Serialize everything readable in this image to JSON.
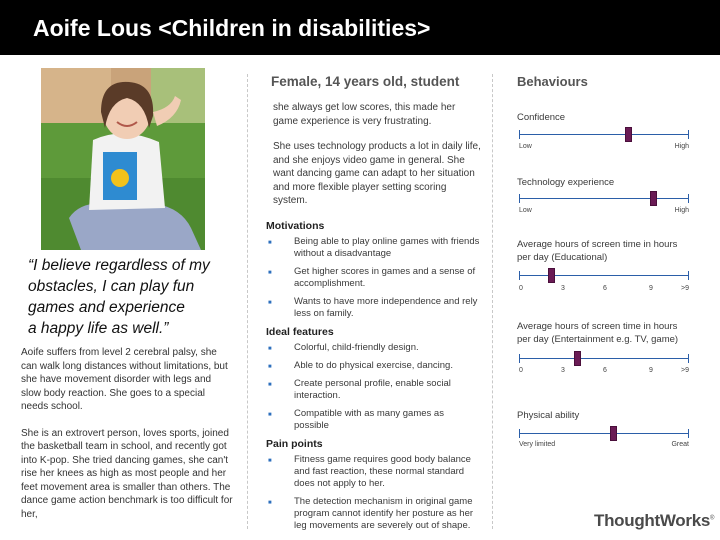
{
  "title": "Aoife Lous <Children in disabilities>",
  "quote": {
    "lines": [
      "“I believe regardless of my",
      "obstacles, I can play fun",
      "games and experience",
      "a happy life as well.”"
    ]
  },
  "bio": {
    "paragraph1": "Aoife suffers from level 2 cerebral palsy, she can walk long distances without limitations, but she have movement disorder with legs and slow body reaction. She goes to a special needs school.",
    "paragraph2": "She is an extrovert person, loves sports, joined the basketball team in school, and recently got into K-pop. She tried dancing games, she can't rise her knees as high as most people and her feet movement area is smaller than others. The dance game action benchmark is too difficult for her,"
  },
  "profile": {
    "heading": "Female, 14 years old, student",
    "text1": "she always get low scores, this made her game experience is very frustrating.",
    "text2": "She uses technology products a lot in daily life, and she enjoys video game in general. She want dancing game can adapt to her situation and more flexible player setting scoring system."
  },
  "motivations": {
    "title": "Motivations",
    "items": [
      "Being able to play online games with friends without a disadvantage",
      "Get higher scores in games and a sense of accomplishment.",
      "Wants to have more independence and rely less on family."
    ]
  },
  "ideal_features": {
    "title": "Ideal features",
    "items": [
      "Colorful, child-friendly design.",
      "Able to do physical exercise, dancing.",
      "Create personal profile, enable social interaction.",
      "Compatible with as many games as possible"
    ]
  },
  "pain_points": {
    "title": "Pain points",
    "items": [
      "Fitness game requires good body balance and fast reaction, these normal standard does not apply to her.",
      "The detection mechanism in original game program cannot identify her posture as her leg movements are severely out of shape."
    ]
  },
  "behaviours": {
    "title": "Behaviours",
    "sliders": [
      {
        "label": "Confidence",
        "low": "Low",
        "high": "High",
        "level": 0.64
      },
      {
        "label": "Technology experience",
        "low": "Low",
        "high": "High",
        "level": 0.79
      },
      {
        "label": "Average hours of screen time in hours per day (Educational)",
        "ticks": [
          "0",
          "3",
          "6",
          "9",
          ">9"
        ],
        "level": 0.19
      },
      {
        "label": "Average hours of screen time in hours per day (Entertainment e.g. TV, game)",
        "ticks": [
          "0",
          "3",
          "6",
          "9",
          ">9"
        ],
        "level": 0.34
      },
      {
        "label": "Physical ability",
        "low": "Very limited",
        "high": "Great",
        "level": 0.55
      }
    ]
  },
  "colors": {
    "header_bg": "#000000",
    "slider_track": "#2b5ea8",
    "slider_knob": "#6a1b55",
    "bullet": "#2d6fbd"
  },
  "logo": "ThoughtWorks"
}
